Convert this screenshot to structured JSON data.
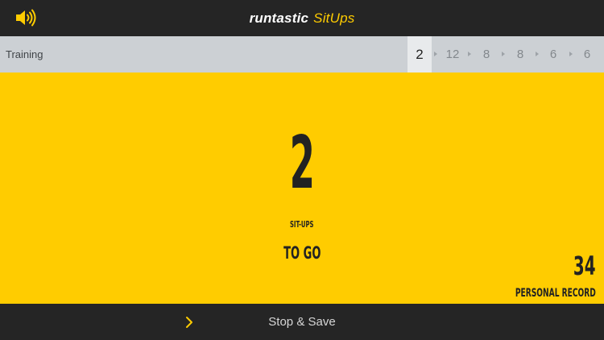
{
  "header": {
    "brand": "runtastic",
    "product": "SitUps",
    "sound_icon": "speaker-icon"
  },
  "training": {
    "label": "Training",
    "sets": [
      "2",
      "12",
      "8",
      "8",
      "6",
      "6"
    ],
    "active_set_index": 0
  },
  "counter": {
    "value": "2",
    "unit": "SIT-UPS",
    "caption": "TO GO"
  },
  "record": {
    "value": "34",
    "label": "PERSONAL RECORD"
  },
  "footer": {
    "icon": "chevron-right-icon",
    "stop_label": "Stop & Save"
  },
  "colors": {
    "accent": "#ffcc00",
    "bar": "#252525",
    "training_bar": "#ccd0d4"
  }
}
